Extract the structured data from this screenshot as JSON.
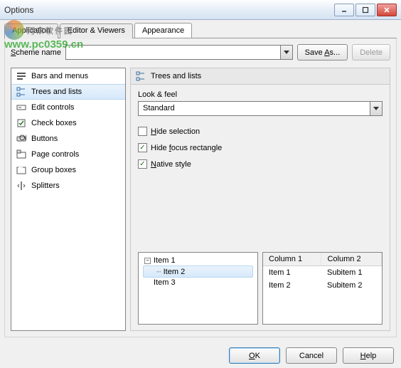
{
  "window": {
    "title": "Options"
  },
  "watermark": {
    "cn": "河东软件园",
    "url": "www.pc0359.cn"
  },
  "tabs": [
    {
      "label": "Application"
    },
    {
      "label": "Editor & Viewers"
    },
    {
      "label": "Appearance"
    }
  ],
  "scheme": {
    "label": "Scheme name",
    "value": "",
    "saveAs": "Save As...",
    "delete": "Delete"
  },
  "categories": [
    {
      "label": "Bars and menus",
      "icon": "bars-menus-icon"
    },
    {
      "label": "Trees and lists",
      "icon": "trees-lists-icon"
    },
    {
      "label": "Edit controls",
      "icon": "edit-controls-icon"
    },
    {
      "label": "Check boxes",
      "icon": "check-boxes-icon"
    },
    {
      "label": "Buttons",
      "icon": "buttons-icon"
    },
    {
      "label": "Page controls",
      "icon": "page-controls-icon"
    },
    {
      "label": "Group boxes",
      "icon": "group-boxes-icon"
    },
    {
      "label": "Splitters",
      "icon": "splitters-icon"
    }
  ],
  "panel": {
    "header": "Trees and lists",
    "lookFeelLabel": "Look & feel",
    "lookFeelValue": "Standard",
    "hideSelection": {
      "label": "Hide selection",
      "checked": false,
      "accel": "H"
    },
    "hideFocus": {
      "label": "Hide focus rectangle",
      "checked": true,
      "accel": "f"
    },
    "nativeStyle": {
      "label": "Native style",
      "checked": true,
      "accel": "N"
    }
  },
  "previewTree": {
    "items": [
      {
        "label": "Item 1"
      },
      {
        "label": "Item 2"
      },
      {
        "label": "Item 3"
      }
    ]
  },
  "previewList": {
    "columns": [
      "Column 1",
      "Column 2"
    ],
    "rows": [
      [
        "Item 1",
        "Subitem 1"
      ],
      [
        "Item 2",
        "Subitem 2"
      ]
    ]
  },
  "footer": {
    "ok": "OK",
    "cancel": "Cancel",
    "help": "Help"
  }
}
